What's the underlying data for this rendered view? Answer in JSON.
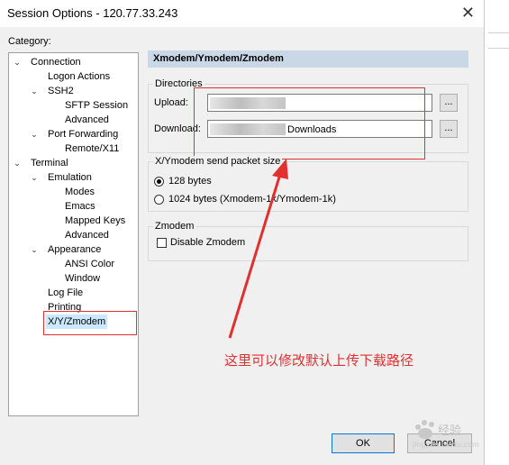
{
  "window": {
    "title": "Session Options - 120.77.33.243",
    "close_glyph": "✕"
  },
  "category_label": "Category:",
  "tree": {
    "items": [
      {
        "label": "Connection",
        "toggle": "⌄"
      },
      {
        "label": "Logon Actions"
      },
      {
        "label": "SSH2",
        "toggle": "⌄"
      },
      {
        "label": "SFTP Session"
      },
      {
        "label": "Advanced"
      },
      {
        "label": "Port Forwarding",
        "toggle": "⌄"
      },
      {
        "label": "Remote/X11"
      },
      {
        "label": "Terminal",
        "toggle": "⌄"
      },
      {
        "label": "Emulation",
        "toggle": "⌄"
      },
      {
        "label": "Modes"
      },
      {
        "label": "Emacs"
      },
      {
        "label": "Mapped Keys"
      },
      {
        "label": "Advanced"
      },
      {
        "label": "Appearance",
        "toggle": "⌄"
      },
      {
        "label": "ANSI Color"
      },
      {
        "label": "Window"
      },
      {
        "label": "Log File"
      },
      {
        "label": "Printing"
      },
      {
        "label": "X/Y/Zmodem",
        "selected": true
      }
    ]
  },
  "panel": {
    "header": "Xmodem/Ymodem/Zmodem",
    "directories": {
      "label": "Directories",
      "upload_label": "Upload:",
      "upload_value": "",
      "download_label": "Download:",
      "download_value": "Downloads",
      "browse_label": "..."
    },
    "send_packet": {
      "label": "X/Ymodem send packet size",
      "option1": "128 bytes",
      "option2": "1024 bytes  (Xmodem-1k/Ymodem-1k)",
      "selected": "128 bytes"
    },
    "zmodem": {
      "label": "Zmodem",
      "disable_label": "Disable Zmodem",
      "checked": false
    }
  },
  "annotation": {
    "text": "这里可以修改默认上传下载路径",
    "color": "#e03030"
  },
  "buttons": {
    "ok": "OK",
    "cancel": "Cancel"
  },
  "watermark": {
    "text": "Baidu 经验",
    "sub": "jingyan.baidu.com"
  }
}
